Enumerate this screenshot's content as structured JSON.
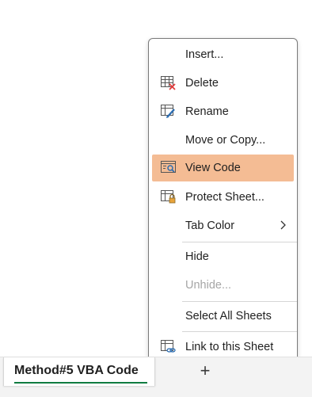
{
  "sheet_tabs": {
    "active_tab_label": "Method#5 VBA Code",
    "add_sheet_symbol": "+"
  },
  "context_menu": {
    "items": [
      {
        "label": "Insert...",
        "icon": null,
        "state": "normal"
      },
      {
        "label": "Delete",
        "icon": "delete-sheet-icon",
        "state": "normal"
      },
      {
        "label": "Rename",
        "icon": "rename-sheet-icon",
        "state": "normal"
      },
      {
        "label": "Move or Copy...",
        "icon": null,
        "state": "normal"
      },
      {
        "label": "View Code",
        "icon": "view-code-icon",
        "state": "highlighted"
      },
      {
        "label": "Protect Sheet...",
        "icon": "protect-sheet-icon",
        "state": "normal"
      },
      {
        "label": "Tab Color",
        "icon": null,
        "state": "normal",
        "submenu": true
      },
      {
        "label": "Hide",
        "icon": null,
        "state": "normal"
      },
      {
        "label": "Unhide...",
        "icon": null,
        "state": "disabled"
      },
      {
        "label": "Select All Sheets",
        "icon": null,
        "state": "normal"
      },
      {
        "label": "Link to this Sheet",
        "icon": "link-sheet-icon",
        "state": "normal"
      }
    ]
  },
  "colors": {
    "highlight": "#f4bc94",
    "tab_underline": "#107c41",
    "delete_x": "#e23c3c",
    "lock": "#e8a33a",
    "icon_accent_blue": "#2b6cb0"
  }
}
